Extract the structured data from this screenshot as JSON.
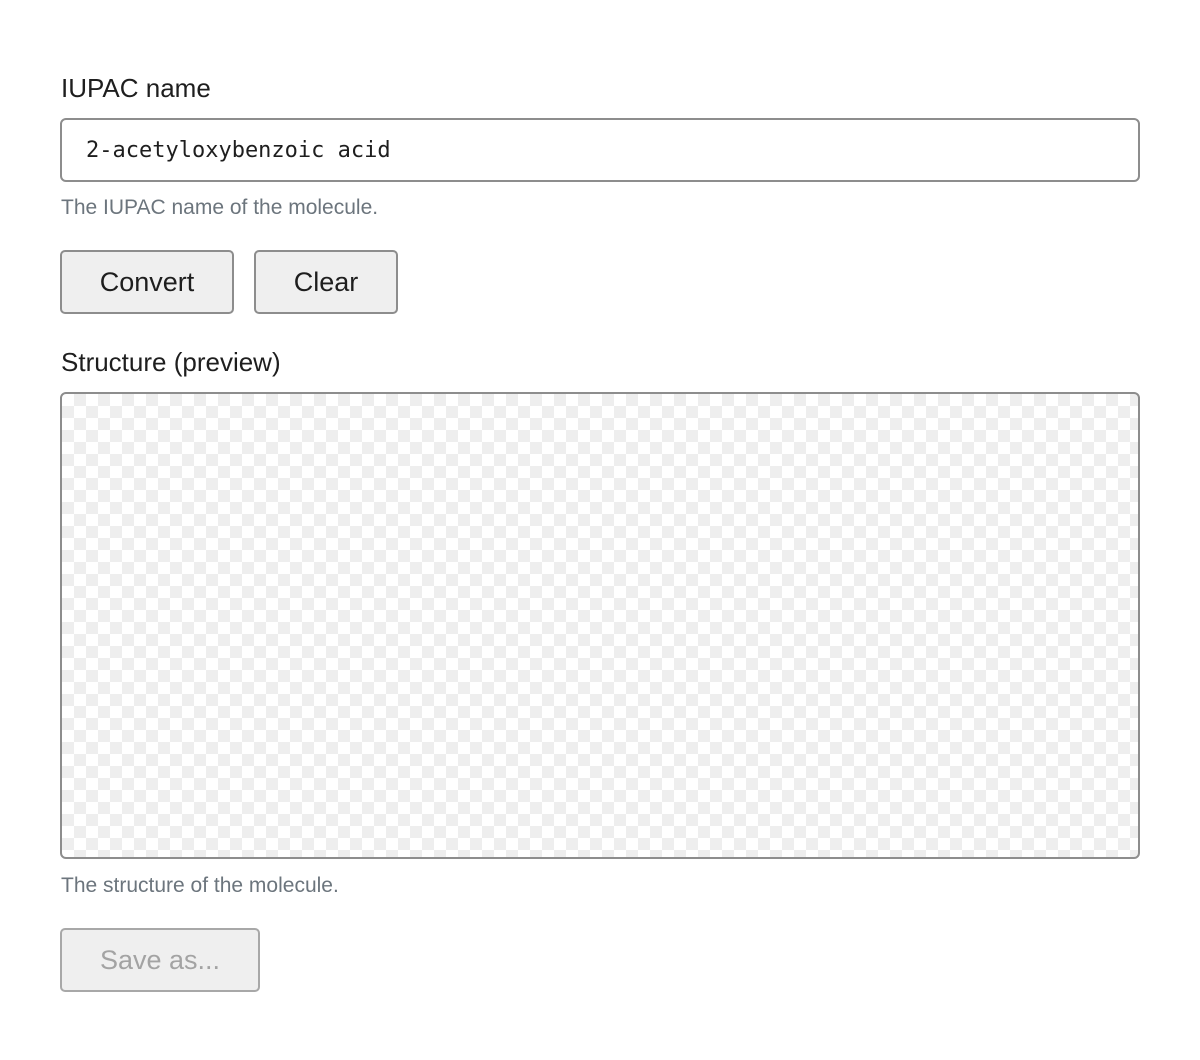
{
  "iupac": {
    "label": "IUPAC name",
    "value": "2-acetyloxybenzoic acid",
    "help": "The IUPAC name of the molecule."
  },
  "actions": {
    "convert_label": "Convert",
    "clear_label": "Clear"
  },
  "structure": {
    "label": "Structure (preview)",
    "help": "The structure of the molecule."
  },
  "save": {
    "label": "Save as...",
    "disabled": true
  }
}
